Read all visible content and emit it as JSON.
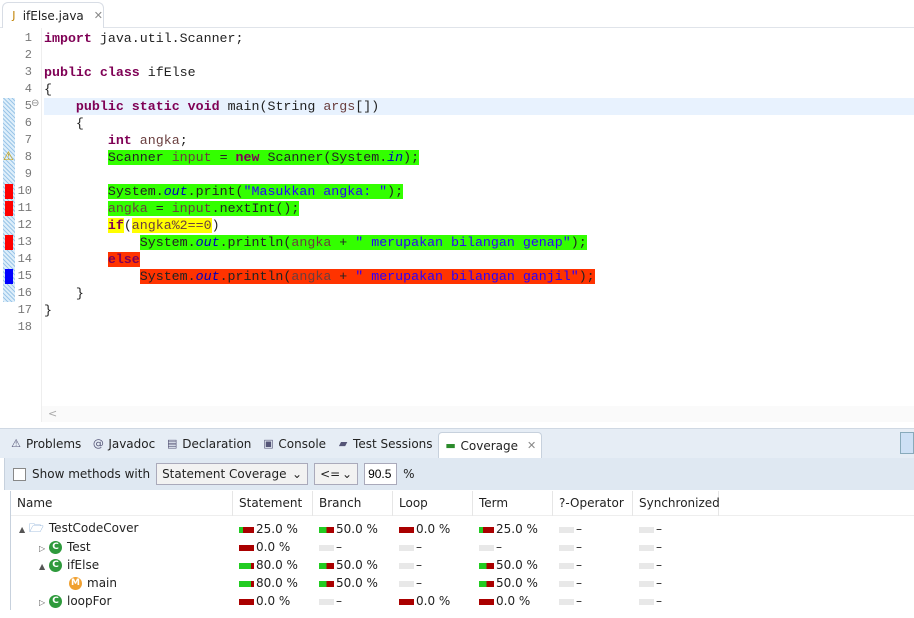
{
  "editor": {
    "tab_label": "ifElse.java",
    "lines": [
      {
        "n": "1",
        "segs": [
          {
            "t": "import",
            "c": "kw"
          },
          {
            "t": " java.util.Scanner;"
          }
        ]
      },
      {
        "n": "2",
        "segs": []
      },
      {
        "n": "3",
        "segs": [
          {
            "t": "public",
            "c": "kw"
          },
          {
            "t": " "
          },
          {
            "t": "class",
            "c": "kw"
          },
          {
            "t": " ifElse"
          }
        ]
      },
      {
        "n": "4",
        "segs": [
          {
            "t": "{"
          }
        ]
      },
      {
        "n": "5",
        "cur": true,
        "hatch": true,
        "fold": true,
        "segs": [
          {
            "t": "    "
          },
          {
            "t": "public",
            "c": "kw"
          },
          {
            "t": " "
          },
          {
            "t": "static",
            "c": "kw"
          },
          {
            "t": " "
          },
          {
            "t": "void",
            "c": "kw"
          },
          {
            "t": " main(String "
          },
          {
            "t": "args",
            "c": "var"
          },
          {
            "t": "[])"
          }
        ]
      },
      {
        "n": "6",
        "hatch": true,
        "segs": [
          {
            "t": "    {"
          }
        ]
      },
      {
        "n": "7",
        "hatch": true,
        "segs": [
          {
            "t": "        "
          },
          {
            "t": "int",
            "c": "kw"
          },
          {
            "t": " "
          },
          {
            "t": "angka",
            "c": "var"
          },
          {
            "t": ";"
          }
        ]
      },
      {
        "n": "8",
        "hatch": true,
        "warn": true,
        "segs": [
          {
            "t": "        "
          },
          {
            "t": "Scanner ",
            "bg": "#33ff00"
          },
          {
            "t": "input",
            "c": "var",
            "bg": "#33ff00"
          },
          {
            "t": " = ",
            "bg": "#33ff00"
          },
          {
            "t": "new",
            "c": "kw",
            "bg": "#33ff00"
          },
          {
            "t": " Scanner(System.",
            "bg": "#33ff00"
          },
          {
            "t": "in",
            "c": "fld",
            "bg": "#33ff00"
          },
          {
            "t": ");",
            "bg": "#33ff00"
          }
        ]
      },
      {
        "n": "9",
        "hatch": true,
        "segs": []
      },
      {
        "n": "10",
        "mark": "#ff0000",
        "segs": [
          {
            "t": "        "
          },
          {
            "t": "System.",
            "bg": "#33ff00"
          },
          {
            "t": "out",
            "c": "fld",
            "bg": "#33ff00"
          },
          {
            "t": ".print(",
            "bg": "#33ff00"
          },
          {
            "t": "\"Masukkan angka: \"",
            "c": "str",
            "bg": "#33ff00"
          },
          {
            "t": ");",
            "bg": "#33ff00"
          }
        ]
      },
      {
        "n": "11",
        "mark": "#ff0000",
        "segs": [
          {
            "t": "        "
          },
          {
            "t": "angka",
            "c": "var",
            "bg": "#33ff00"
          },
          {
            "t": " = ",
            "bg": "#33ff00"
          },
          {
            "t": "input",
            "c": "var",
            "bg": "#33ff00"
          },
          {
            "t": ".nextInt();",
            "bg": "#33ff00"
          }
        ]
      },
      {
        "n": "12",
        "hatch": true,
        "segs": [
          {
            "t": "        "
          },
          {
            "t": "if",
            "c": "kw",
            "bg": "#ffff00"
          },
          {
            "t": "("
          },
          {
            "t": "angka%2==0",
            "c": "var",
            "bg": "#ffff00"
          },
          {
            "t": ")"
          }
        ]
      },
      {
        "n": "13",
        "mark": "#ff0000",
        "segs": [
          {
            "t": "            "
          },
          {
            "t": "System.",
            "bg": "#33ff00"
          },
          {
            "t": "out",
            "c": "fld",
            "bg": "#33ff00"
          },
          {
            "t": ".println(",
            "bg": "#33ff00"
          },
          {
            "t": "angka",
            "c": "var",
            "bg": "#33ff00"
          },
          {
            "t": " + ",
            "bg": "#33ff00"
          },
          {
            "t": "\" merupakan bilangan genap\"",
            "c": "str",
            "bg": "#33ff00"
          },
          {
            "t": ");",
            "bg": "#33ff00"
          }
        ]
      },
      {
        "n": "14",
        "hatch": true,
        "segs": [
          {
            "t": "        "
          },
          {
            "t": "else",
            "c": "kw",
            "bg": "#ff3300"
          }
        ]
      },
      {
        "n": "15",
        "mark": "#0000ff",
        "segs": [
          {
            "t": "            "
          },
          {
            "t": "System.",
            "bg": "#ff3300"
          },
          {
            "t": "out",
            "c": "fld",
            "bg": "#ff3300"
          },
          {
            "t": ".println(",
            "bg": "#ff3300"
          },
          {
            "t": "angka",
            "c": "var",
            "bg": "#ff3300"
          },
          {
            "t": " + ",
            "bg": "#ff3300"
          },
          {
            "t": "\" merupakan bilangan ganjil\"",
            "c": "str",
            "bg": "#ff3300"
          },
          {
            "t": ");",
            "bg": "#ff3300"
          }
        ]
      },
      {
        "n": "16",
        "hatch": true,
        "segs": [
          {
            "t": "    }"
          }
        ]
      },
      {
        "n": "17",
        "segs": [
          {
            "t": "}"
          }
        ]
      },
      {
        "n": "18",
        "segs": []
      }
    ],
    "hscroll_arrow": "<"
  },
  "panel": {
    "tabs": [
      {
        "label": "Problems",
        "icon": "problems-icon",
        "glyph": "⚠"
      },
      {
        "label": "Javadoc",
        "icon": "at-icon",
        "glyph": "@"
      },
      {
        "label": "Declaration",
        "icon": "declaration-icon",
        "glyph": "▤"
      },
      {
        "label": "Console",
        "icon": "console-icon",
        "glyph": "▣"
      },
      {
        "label": "Test Sessions",
        "icon": "test-sessions-icon",
        "glyph": "▰"
      },
      {
        "label": "Coverage",
        "icon": "coverage-icon",
        "glyph": "▬",
        "active": true
      }
    ],
    "toolbar": {
      "show_methods_label": "Show methods with",
      "criterion": "Statement Coverage",
      "operator": "<=",
      "threshold": "90.5",
      "percent": "%"
    },
    "columns": [
      "Name",
      "Statement",
      "Branch",
      "Loop",
      "Term",
      "?-Operator",
      "Synchronized"
    ],
    "rows": [
      {
        "name": "TestCodeCover",
        "kind": "folder",
        "depth": 0,
        "twisty": "▲",
        "cells": [
          [
            "25.0 %",
            0.25
          ],
          [
            "50.0 %",
            0.5
          ],
          [
            "0.0 %",
            0
          ],
          [
            "25.0 %",
            0.25
          ],
          [
            "–",
            null
          ],
          [
            "–",
            null
          ]
        ]
      },
      {
        "name": "Test",
        "kind": "class",
        "depth": 1,
        "twisty": "▷",
        "cells": [
          [
            "0.0 %",
            0
          ],
          [
            "–",
            null
          ],
          [
            "–",
            null
          ],
          [
            "–",
            null
          ],
          [
            "–",
            null
          ],
          [
            "–",
            null
          ]
        ]
      },
      {
        "name": "ifElse",
        "kind": "class",
        "depth": 1,
        "twisty": "▲",
        "cells": [
          [
            "80.0 %",
            0.8
          ],
          [
            "50.0 %",
            0.5
          ],
          [
            "–",
            null
          ],
          [
            "50.0 %",
            0.5
          ],
          [
            "–",
            null
          ],
          [
            "–",
            null
          ]
        ]
      },
      {
        "name": "main",
        "kind": "method",
        "depth": 2,
        "twisty": "",
        "cells": [
          [
            "80.0 %",
            0.8
          ],
          [
            "50.0 %",
            0.5
          ],
          [
            "–",
            null
          ],
          [
            "50.0 %",
            0.5
          ],
          [
            "–",
            null
          ],
          [
            "–",
            null
          ]
        ]
      },
      {
        "name": "loopFor",
        "kind": "class",
        "depth": 1,
        "twisty": "▷",
        "cells": [
          [
            "0.0 %",
            0
          ],
          [
            "–",
            null
          ],
          [
            "0.0 %",
            0
          ],
          [
            "0.0 %",
            0
          ],
          [
            "–",
            null
          ],
          [
            "–",
            null
          ]
        ]
      }
    ]
  },
  "colors": {
    "covered": "#22cc22",
    "uncovered": "#aa0000",
    "na": "#e8e8e8"
  }
}
